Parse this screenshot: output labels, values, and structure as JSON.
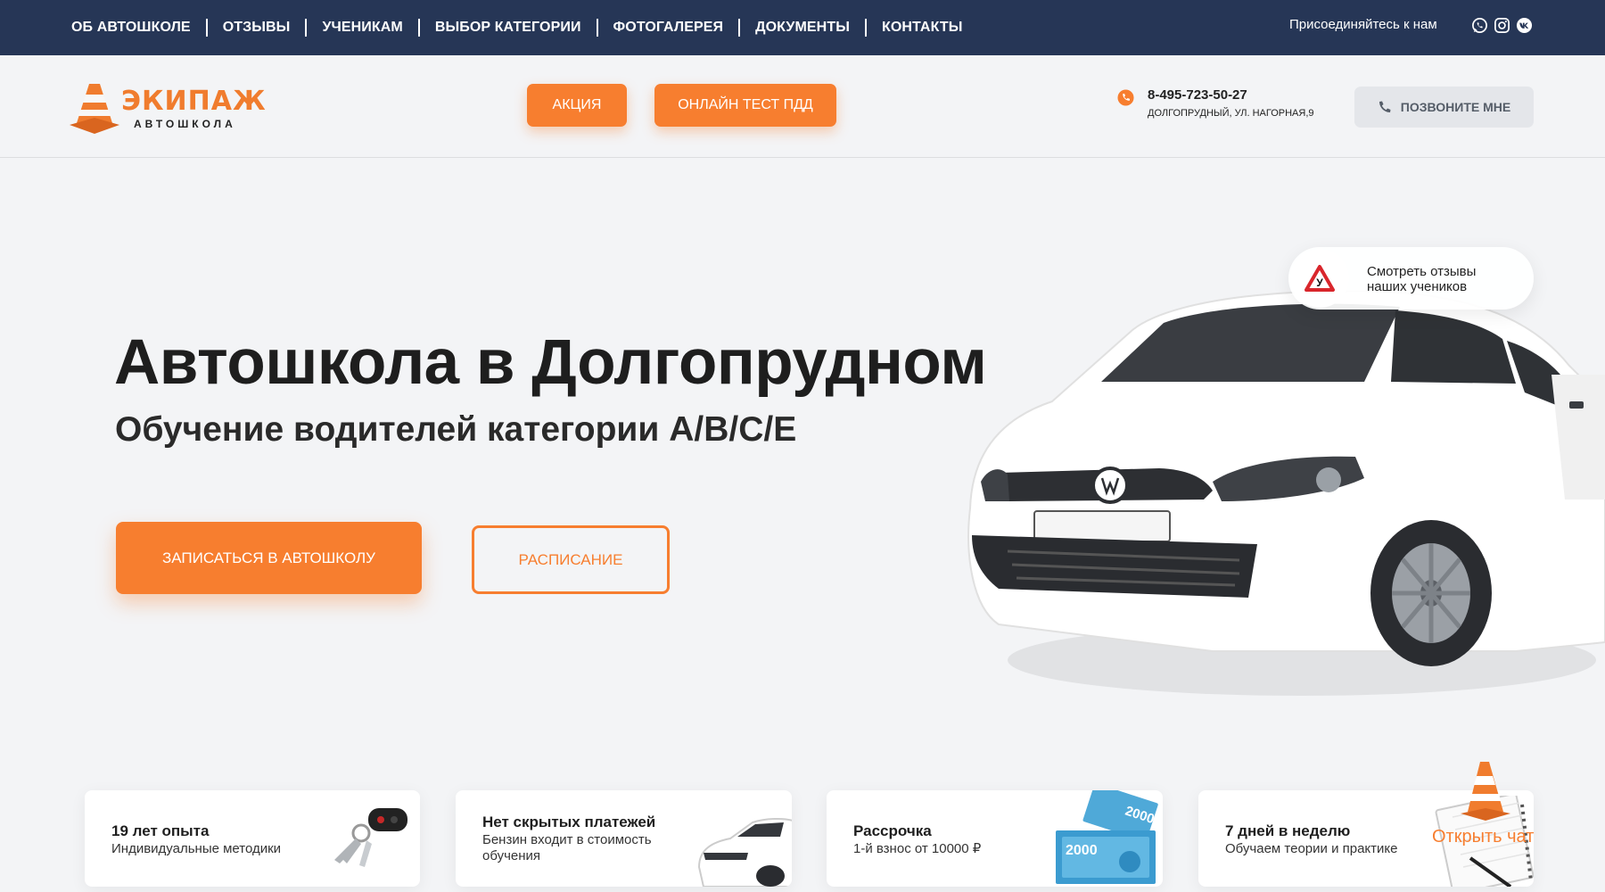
{
  "topnav": {
    "items": [
      "ОБ АВТОШКОЛЕ",
      "ОТЗЫВЫ",
      "УЧЕНИКАМ",
      "ВЫБОР КАТЕГОРИИ",
      "ФОТОГАЛЕРЕЯ",
      "ДОКУМЕНТЫ",
      "КОНТАКТЫ"
    ],
    "join_text": "Присоединяйтесь к нам",
    "social_icons": [
      "whatsapp-icon",
      "instagram-icon",
      "vk-icon"
    ]
  },
  "header": {
    "logo_title": "ЭКИПАЖ",
    "logo_subtitle": "АВТОШКОЛА",
    "promo_button": "АКЦИЯ",
    "online_test_button": "ОНЛАЙН ТЕСТ ПДД",
    "phone": "8-495-723-50-27",
    "address": "ДОЛГОПРУДНЫЙ, УЛ. НАГОРНАЯ,9",
    "callback_button": "ПОЗВОНИТЕ МНЕ"
  },
  "hero": {
    "title": "Автошкола в Долгопрудном",
    "subtitle": "Обучение водителей категории A/B/C/E",
    "signup_button": "ЗАПИСАТЬСЯ В АВТОШКОЛУ",
    "schedule_button": "РАСПИСАНИЕ",
    "reviews_link": "Смотреть отзывы наших учеников",
    "reviews_badge_letter": "У"
  },
  "features": [
    {
      "title": "19 лет опыта",
      "desc": "Индивидуальные методики",
      "icon": "car-keys-icon"
    },
    {
      "title": "Нет скрытых платежей",
      "desc": "Бензин входит в стоимость обучения",
      "icon": "car-icon"
    },
    {
      "title": "Рассрочка",
      "desc": "1-й взнос от 10000 ₽",
      "icon": "banknotes-icon",
      "note_value": "2000"
    },
    {
      "title": "7 дней в неделю",
      "desc": "Обучаем теории и практике",
      "icon": "notebook-icon"
    }
  ],
  "chat": {
    "label": "Открыть чат"
  },
  "colors": {
    "accent": "#f77e2f",
    "nav_bg": "#263656",
    "page_bg": "#f3f4f6"
  }
}
